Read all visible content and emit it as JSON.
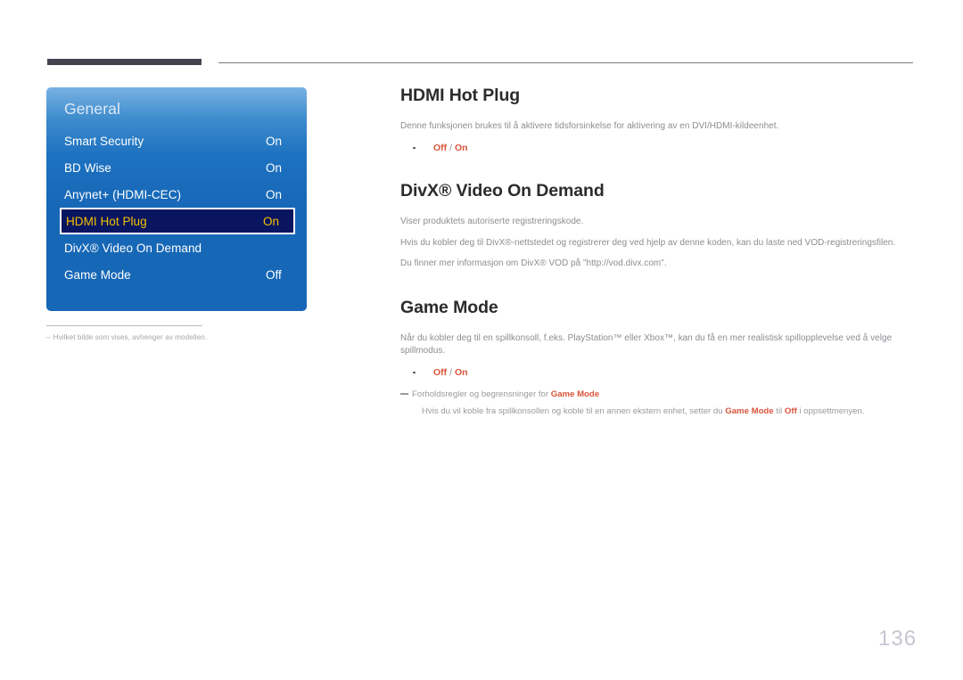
{
  "page": {
    "number": "136"
  },
  "osd": {
    "title": "General",
    "rows": [
      {
        "label": "Smart Security",
        "value": "On",
        "selected": false
      },
      {
        "label": "BD Wise",
        "value": "On",
        "selected": false
      },
      {
        "label": "Anynet+ (HDMI-CEC)",
        "value": "On",
        "selected": false
      },
      {
        "label": "HDMI Hot Plug",
        "value": "On",
        "selected": true
      },
      {
        "label": "DivX® Video On Demand",
        "value": "",
        "selected": false
      },
      {
        "label": "Game Mode",
        "value": "Off",
        "selected": false
      }
    ],
    "note": {
      "dash": "–",
      "text": "Hvilket bilde som vises, avhenger av modellen."
    }
  },
  "article": {
    "sections": [
      {
        "title": "HDMI Hot Plug",
        "paragraphs": [
          "Denne funksjonen brukes til å aktivere tidsforsinkelse for aktivering av en DVI/HDMI-kildeenhet."
        ],
        "options": [
          {
            "first": "Off",
            "sep": " / ",
            "second": "On"
          }
        ]
      },
      {
        "title": "DivX® Video On Demand",
        "paragraphs": [
          "Viser produktets autoriserte registreringskode.",
          "Hvis du kobler deg til DivX®-nettstedet og registrerer deg ved hjelp av denne koden, kan du laste ned VOD-registreringsfilen.",
          "Du finner mer informasjon om DivX® VOD på \"http://vod.divx.com\"."
        ],
        "options": []
      },
      {
        "title": "Game Mode",
        "paragraphs": [
          "Når du kobler deg til en spillkonsoll, f.eks. PlayStation™ eller Xbox™, kan du få en mer realistisk spillopplevelse ved å velge spillmodus."
        ],
        "options": [
          {
            "first": "Off",
            "sep": " / ",
            "second": "On"
          }
        ]
      }
    ],
    "caution": {
      "head_prefix": "Forholdsregler og begrensninger for ",
      "head_keyword": "Game Mode",
      "body_part1": "Hvis du  vil koble fra spillkonsollen og koble til en annen ekstern enhet, setter du ",
      "body_kw1": "Game Mode",
      "body_part2": " til ",
      "body_kw2": "Off",
      "body_part3": " i oppsettmenyen."
    }
  },
  "colors": {
    "accent_red": "#d9543a",
    "osd_blue": "#1667b6",
    "osd_selected_bg": "#0a1560",
    "osd_selected_text": "#f2c100",
    "header_bar": "#454350"
  }
}
